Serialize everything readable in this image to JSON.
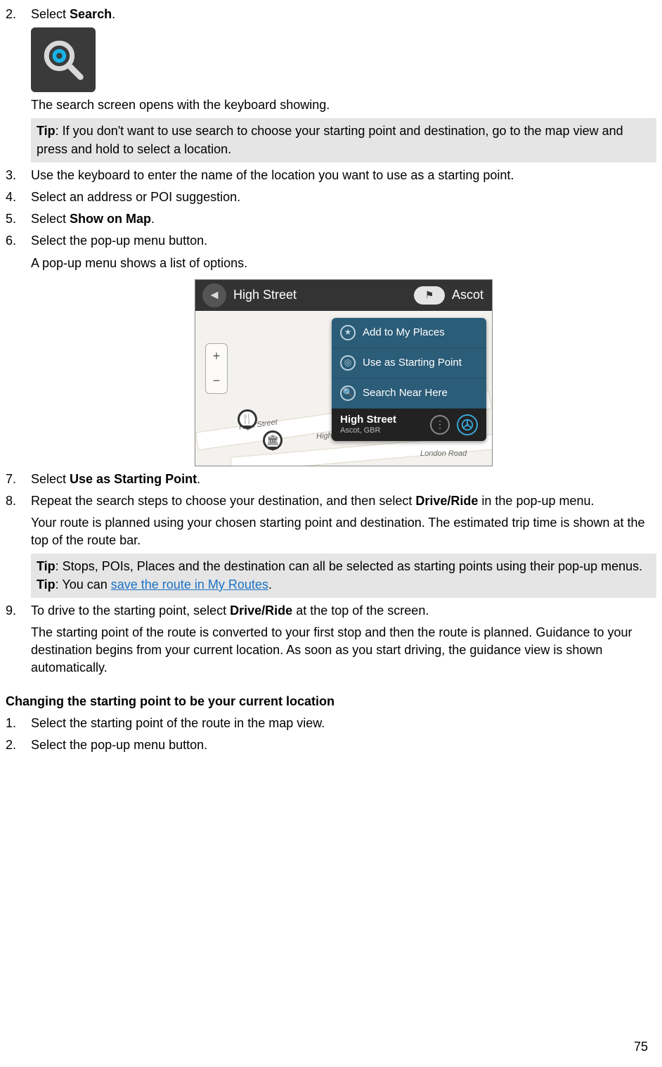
{
  "step2": {
    "prefix": "Select ",
    "bold": "Search",
    "suffix": ".",
    "after_icon": "The search screen opens with the keyboard showing."
  },
  "tip1": {
    "label": "Tip",
    "text": ": If you don't want to use search to choose your starting point and destination, go to the map view and press and hold to select a location."
  },
  "step3": "Use the keyboard to enter the name of the location you want to use as a starting point.",
  "step4": "Select an address or POI suggestion.",
  "step5": {
    "prefix": "Select ",
    "bold": "Show on Map",
    "suffix": "."
  },
  "step6": {
    "line1": "Select the pop-up menu button.",
    "line2": "A pop-up menu shows a list of options."
  },
  "map": {
    "header_loc": "High Street",
    "header_right": "Ascot",
    "road1": "High Street",
    "road2": "High Street",
    "road3": "London Road",
    "opt1": "Add to My Places",
    "opt2": "Use as Starting Point",
    "opt3": "Search Near Here",
    "sel_title": "High Street",
    "sel_sub": "Ascot, GBR"
  },
  "step7": {
    "prefix": "Select ",
    "bold": "Use as Starting Point",
    "suffix": "."
  },
  "step8": {
    "p1a": "Repeat the search steps to choose your destination, and then select ",
    "p1b": "Drive/Ride",
    "p1c": " in the pop-up menu.",
    "p2": "Your route is planned using your chosen starting point and destination. The estimated trip time is shown at the top of the route bar."
  },
  "tip2": {
    "label": "Tip",
    "text": ": Stops, POIs, Places and the destination can all be selected as starting points using their pop-up menus."
  },
  "tip3": {
    "label": "Tip",
    "prefix": ": You can ",
    "link": "save the route in My Routes",
    "suffix": "."
  },
  "step9": {
    "p1a": "To drive to the starting point, select ",
    "p1b": "Drive/Ride",
    "p1c": " at the top of the screen.",
    "p2": "The starting point of the route is converted to your first stop and then the route is planned. Guidance to your destination begins from your current location. As soon as you start driving, the guidance view is shown automatically."
  },
  "sub": {
    "heading": "Changing the starting point to be your current location",
    "s1": "Select the starting point of the route in the map view.",
    "s2": "Select the pop-up menu button."
  },
  "page": "75"
}
